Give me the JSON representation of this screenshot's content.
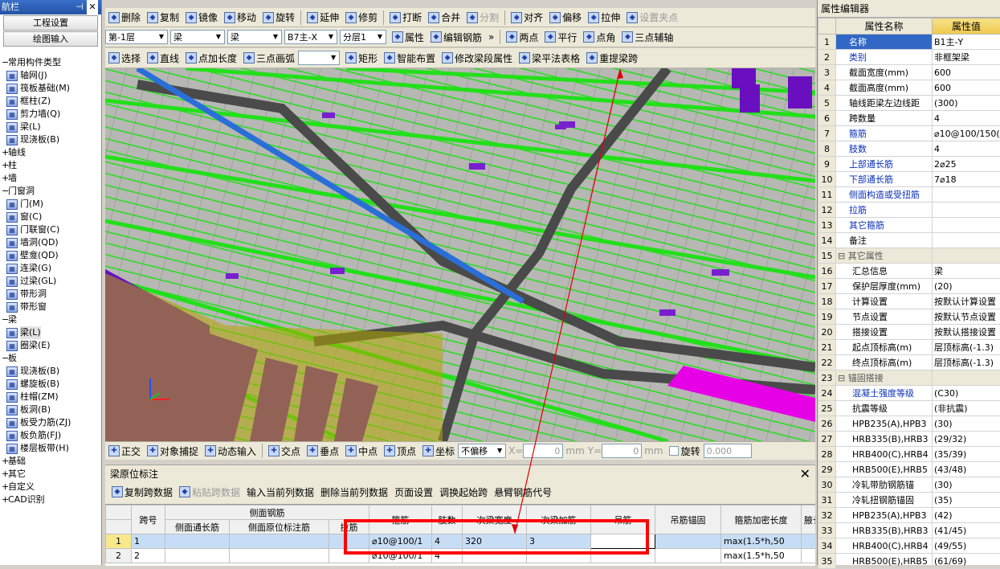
{
  "nav": {
    "title": "航栏",
    "buttons": [
      "工程设置",
      "绘图输入"
    ],
    "tree": [
      {
        "type": "grp",
        "label": "常用构件类型",
        "icon": "minus"
      },
      {
        "type": "itm",
        "label": "轴网(J)",
        "icon": "grid-icon"
      },
      {
        "type": "itm",
        "label": "筏板基础(M)",
        "icon": "raft-icon"
      },
      {
        "type": "itm",
        "label": "框柱(Z)",
        "icon": "column-icon"
      },
      {
        "type": "itm",
        "label": "剪力墙(Q)",
        "icon": "wall-icon"
      },
      {
        "type": "itm",
        "label": "梁(L)",
        "icon": "beam-icon"
      },
      {
        "type": "itm",
        "label": "现浇板(B)",
        "icon": "slab-icon"
      },
      {
        "type": "grp",
        "label": "轴线",
        "icon": "plus"
      },
      {
        "type": "grp",
        "label": "柱",
        "icon": "plus"
      },
      {
        "type": "grp",
        "label": "墙",
        "icon": "plus"
      },
      {
        "type": "grp",
        "label": "门窗洞",
        "icon": "minus"
      },
      {
        "type": "itm",
        "label": "门(M)",
        "icon": "door-icon"
      },
      {
        "type": "itm",
        "label": "窗(C)",
        "icon": "window-icon"
      },
      {
        "type": "itm",
        "label": "门联窗(C)",
        "icon": "doorwindow-icon"
      },
      {
        "type": "itm",
        "label": "墙洞(QD)",
        "icon": "wallhole-icon"
      },
      {
        "type": "itm",
        "label": "壁龛(QD)",
        "icon": "niche-icon"
      },
      {
        "type": "itm",
        "label": "连梁(G)",
        "icon": "linkbeam-icon"
      },
      {
        "type": "itm",
        "label": "过梁(GL)",
        "icon": "lintel-icon"
      },
      {
        "type": "itm",
        "label": "带形洞",
        "icon": "striphole-icon"
      },
      {
        "type": "itm",
        "label": "带形窗",
        "icon": "stripwindow-icon"
      },
      {
        "type": "grp",
        "label": "梁",
        "icon": "minus"
      },
      {
        "type": "itm",
        "label": "梁(L)",
        "icon": "beam-icon",
        "selected": true
      },
      {
        "type": "itm",
        "label": "圈梁(E)",
        "icon": "ringbeam-icon"
      },
      {
        "type": "grp",
        "label": "板",
        "icon": "minus"
      },
      {
        "type": "itm",
        "label": "现浇板(B)",
        "icon": "slab-icon"
      },
      {
        "type": "itm",
        "label": "螺旋板(B)",
        "icon": "spiral-icon"
      },
      {
        "type": "itm",
        "label": "柱帽(ZM)",
        "icon": "capital-icon"
      },
      {
        "type": "itm",
        "label": "板洞(B)",
        "icon": "slabhole-icon"
      },
      {
        "type": "itm",
        "label": "板受力筋(ZJ)",
        "icon": "rebar-icon"
      },
      {
        "type": "itm",
        "label": "板负筋(FJ)",
        "icon": "negrebar-icon"
      },
      {
        "type": "itm",
        "label": "楼层板带(H)",
        "icon": "band-icon"
      },
      {
        "type": "grp",
        "label": "基础",
        "icon": "plus"
      },
      {
        "type": "grp",
        "label": "其它",
        "icon": "plus"
      },
      {
        "type": "grp",
        "label": "自定义",
        "icon": "plus"
      },
      {
        "type": "grp",
        "label": "CAD识别",
        "icon": "plus"
      }
    ]
  },
  "toolbar1": [
    "删除",
    "复制",
    "镜像",
    "移动",
    "旋转",
    "延伸",
    "修剪",
    "打断",
    "合并",
    "分割",
    "对齐",
    "偏移",
    "拉伸",
    "设置夹点"
  ],
  "toolbar2": {
    "combos": [
      "第-1层",
      "梁",
      "梁",
      "B7主-X",
      "分层1"
    ],
    "buttons": [
      "属性",
      "编辑钢筋",
      "两点",
      "平行",
      "点角",
      "三点辅轴"
    ]
  },
  "toolbar3": [
    "选择",
    "直线",
    "点加长度",
    "三点画弧",
    "矩形",
    "智能布置",
    "修改梁段属性",
    "梁平法表格",
    "重提梁跨"
  ],
  "snapbar": {
    "items": [
      "正交",
      "对象捕捉",
      "动态输入",
      "交点",
      "垂点",
      "中点",
      "顶点",
      "坐标"
    ],
    "mode": "不偏移",
    "x_label": "X=",
    "x_val": "0",
    "unit": "mm",
    "y_label": "Y=",
    "y_val": "0",
    "rotate_label": "旋转",
    "rotate_val": "0.000"
  },
  "panel": {
    "title": "梁原位标注",
    "tools": [
      "复制跨数据",
      "粘贴跨数据",
      "输入当前列数据",
      "删除当前列数据",
      "页面设置",
      "调换起始跨",
      "悬臂钢筋代号"
    ],
    "group_header": "侧面钢筋",
    "headers": [
      "跨号",
      "侧面通长筋",
      "侧面原位标注筋",
      "拉筋",
      "箍筋",
      "肢数",
      "次梁宽度",
      "次梁加筋",
      "吊筋",
      "吊筋锚固",
      "箍筋加密长度",
      "腋长"
    ],
    "rows": [
      {
        "rn": "1",
        "span": "1",
        "c1": "",
        "c2": "",
        "c3": "",
        "stirrup": "⌀10@100/1",
        "legs": "4",
        "w": "320",
        "add": "3",
        "hang": "",
        "anch": "",
        "len": "max(1.5*h,50",
        "ax": ""
      },
      {
        "rn": "2",
        "span": "2",
        "c1": "",
        "c2": "",
        "c3": "",
        "stirrup": "⌀10@100/1",
        "legs": "4",
        "w": "",
        "add": "",
        "hang": "",
        "anch": "",
        "len": "max(1.5*h,50",
        "ax": ""
      }
    ]
  },
  "prop": {
    "title": "属性编辑器",
    "col_name": "属性名称",
    "col_value": "属性值",
    "rows": [
      {
        "n": "1",
        "k": "名称",
        "v": "B1主-Y",
        "blue": true,
        "sel": true
      },
      {
        "n": "2",
        "k": "类别",
        "v": "非框架梁",
        "blue": true
      },
      {
        "n": "3",
        "k": "截面宽度(mm)",
        "v": "600"
      },
      {
        "n": "4",
        "k": "截面高度(mm)",
        "v": "600"
      },
      {
        "n": "5",
        "k": "轴线距梁左边线距",
        "v": "(300)"
      },
      {
        "n": "6",
        "k": "跨数量",
        "v": "4"
      },
      {
        "n": "7",
        "k": "箍筋",
        "v": "⌀10@100/150(4",
        "blue": true
      },
      {
        "n": "8",
        "k": "肢数",
        "v": "4",
        "blue": true
      },
      {
        "n": "9",
        "k": "上部通长筋",
        "v": "2⌀25",
        "blue": true
      },
      {
        "n": "10",
        "k": "下部通长筋",
        "v": "7⌀18",
        "blue": true
      },
      {
        "n": "11",
        "k": "侧面构造或受扭筋",
        "v": "",
        "blue": true
      },
      {
        "n": "12",
        "k": "拉筋",
        "v": "",
        "blue": true
      },
      {
        "n": "13",
        "k": "其它箍筋",
        "v": "",
        "blue": true
      },
      {
        "n": "14",
        "k": "备注",
        "v": ""
      },
      {
        "n": "15",
        "k": "其它属性",
        "v": "",
        "hdr": true
      },
      {
        "n": "16",
        "k": "汇总信息",
        "v": "梁",
        "sub": true
      },
      {
        "n": "17",
        "k": "保护层厚度(mm)",
        "v": "(20)",
        "sub": true
      },
      {
        "n": "18",
        "k": "计算设置",
        "v": "按默认计算设置",
        "sub": true
      },
      {
        "n": "19",
        "k": "节点设置",
        "v": "按默认节点设置",
        "sub": true
      },
      {
        "n": "20",
        "k": "搭接设置",
        "v": "按默认搭接设置",
        "sub": true
      },
      {
        "n": "21",
        "k": "起点顶标高(m)",
        "v": "层顶标高(-1.3)",
        "sub": true
      },
      {
        "n": "22",
        "k": "终点顶标高(m)",
        "v": "层顶标高(-1.3)",
        "sub": true
      },
      {
        "n": "23",
        "k": "锚固搭接",
        "v": "",
        "hdr": true
      },
      {
        "n": "24",
        "k": "混凝土强度等级",
        "v": "(C30)",
        "sub": true,
        "blue": true
      },
      {
        "n": "25",
        "k": "抗震等级",
        "v": "(非抗震)",
        "sub": true
      },
      {
        "n": "26",
        "k": "HPB235(A),HPB3",
        "v": "(30)",
        "sub": true
      },
      {
        "n": "27",
        "k": "HRB335(B),HRB3",
        "v": "(29/32)",
        "sub": true
      },
      {
        "n": "28",
        "k": "HRB400(C),HRB4",
        "v": "(35/39)",
        "sub": true
      },
      {
        "n": "29",
        "k": "HRB500(E),HRB5",
        "v": "(43/48)",
        "sub": true
      },
      {
        "n": "30",
        "k": "冷轧带肋钢筋锚",
        "v": "(30)",
        "sub": true
      },
      {
        "n": "31",
        "k": "冷轧扭钢筋锚固",
        "v": "(35)",
        "sub": true
      },
      {
        "n": "32",
        "k": "HPB235(A),HPB3",
        "v": "(42)",
        "sub": true
      },
      {
        "n": "33",
        "k": "HRB335(B),HRB3",
        "v": "(41/45)",
        "sub": true
      },
      {
        "n": "34",
        "k": "HRB400(C),HRB4",
        "v": "(49/55)",
        "sub": true
      },
      {
        "n": "35",
        "k": "HRB500(E),HRB5",
        "v": "(61/69)",
        "sub": true
      }
    ]
  },
  "colors": {
    "beam_green": "#22e01a",
    "slab_gray": "#b4b4b4",
    "highlight": "#ff0000",
    "selected_beam": "#2a6fd8"
  }
}
